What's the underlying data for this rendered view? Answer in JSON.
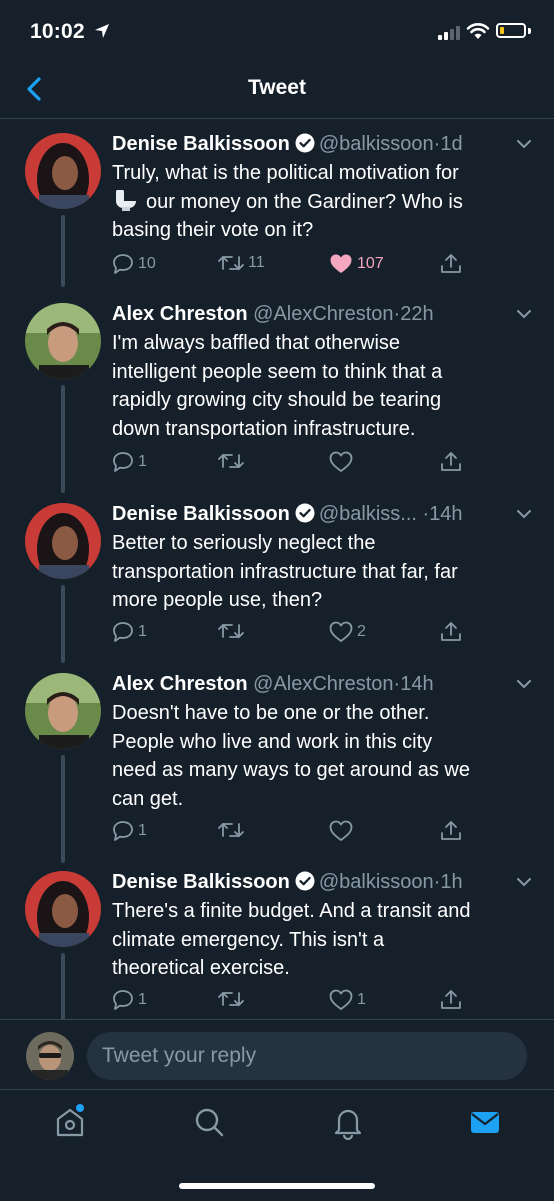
{
  "status_bar": {
    "time": "10:02"
  },
  "nav": {
    "title": "Tweet"
  },
  "tweets": [
    {
      "name": "Denise Balkissoon",
      "verified": true,
      "handle": "@balkissoon",
      "time": "1d",
      "lines": [
        "Truly, what is the political motivation for",
        "our money on the Gardiner? Who is",
        "basing their vote on it?"
      ],
      "emoji": "toilet",
      "replies": "10",
      "retweets": "11",
      "likes": "107",
      "liked": true
    },
    {
      "name": "Alex Chreston",
      "verified": false,
      "handle": "@AlexChreston",
      "time": "22h",
      "lines": [
        "I'm always baffled that otherwise",
        "intelligent people seem to think that a",
        "rapidly growing city should be tearing",
        "down transportation infrastructure."
      ],
      "replies": "1",
      "retweets": "",
      "likes": "",
      "liked": false
    },
    {
      "name": "Denise Balkissoon",
      "verified": true,
      "handle": "@balkiss...",
      "time": "14h",
      "lines": [
        "Better to seriously neglect the",
        "transportation infrastructure that far, far",
        "more people use, then?"
      ],
      "replies": "1",
      "retweets": "",
      "likes": "2",
      "liked": false
    },
    {
      "name": "Alex Chreston",
      "verified": false,
      "handle": "@AlexChreston",
      "time": "14h",
      "lines": [
        "Doesn't have to be one or the other.",
        "People who live and work in this city",
        "need as many ways to get around as we",
        "can get."
      ],
      "replies": "1",
      "retweets": "",
      "likes": "",
      "liked": false
    },
    {
      "name": "Denise Balkissoon",
      "verified": true,
      "handle": "@balkissoon",
      "time": "1h",
      "lines": [
        "There's a finite budget. And a transit and",
        "climate emergency. This isn't a",
        "theoretical exercise."
      ],
      "replies": "1",
      "retweets": "",
      "likes": "1",
      "liked": false
    }
  ],
  "reply": {
    "placeholder": "Tweet your reply"
  },
  "tabbar": {
    "items": [
      "home-icon",
      "search-icon",
      "notifications-icon",
      "messages-icon"
    ]
  },
  "colors": {
    "bg": "#15202b",
    "muted": "#8899a6",
    "accent": "#1da1f2",
    "like": "#e0245e",
    "divider": "#38444d"
  }
}
